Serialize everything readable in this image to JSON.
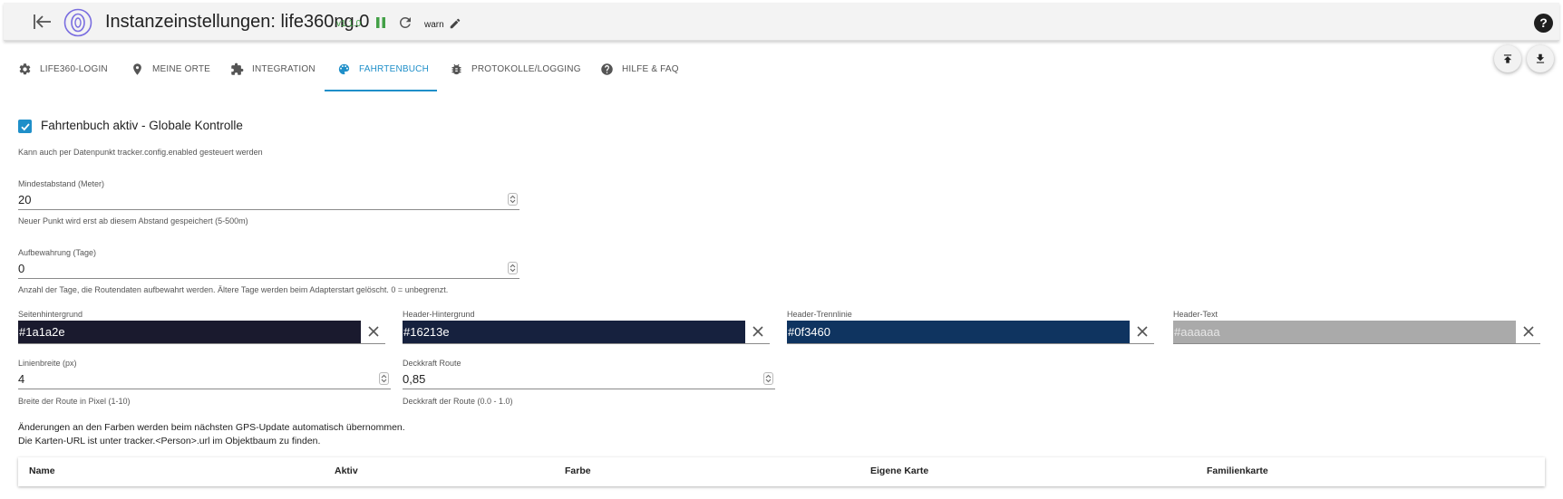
{
  "header": {
    "title": "Instanzeinstellungen: life360ng.0",
    "version": "v1.1.0",
    "log_level": "warn",
    "help_symbol": "?"
  },
  "tabs": [
    {
      "label": "LIFE360-LOGIN",
      "icon": "gear-icon"
    },
    {
      "label": "MEINE ORTE",
      "icon": "map-pin-icon"
    },
    {
      "label": "INTEGRATION",
      "icon": "puzzle-icon"
    },
    {
      "label": "FAHRTENBUCH",
      "icon": "palette-icon",
      "active": true
    },
    {
      "label": "PROTOKOLLE/LOGGING",
      "icon": "bug-icon"
    },
    {
      "label": "HILFE & FAQ",
      "icon": "help-circle-icon"
    }
  ],
  "form": {
    "enabled": {
      "label": "Fahrtenbuch aktiv - Globale Kontrolle",
      "checked": true,
      "help": "Kann auch per Datenpunkt tracker.config.enabled gesteuert werden"
    },
    "min_distance": {
      "label": "Mindestabstand (Meter)",
      "value": "20",
      "help": "Neuer Punkt wird erst ab diesem Abstand gespeichert (5-500m)"
    },
    "retention": {
      "label": "Aufbewahrung (Tage)",
      "value": "0",
      "help": "Anzahl der Tage, die Routendaten aufbewahrt werden. Ältere Tage werden beim Adapterstart gelöscht. 0 = unbegrenzt."
    },
    "colors": [
      {
        "label": "Seitenhintergrund",
        "value": "#1a1a2e",
        "text_color": "#ffffff"
      },
      {
        "label": "Header-Hintergrund",
        "value": "#16213e",
        "text_color": "#ffffff"
      },
      {
        "label": "Header-Trennlinie",
        "value": "#0f3460",
        "text_color": "#ffffff"
      },
      {
        "label": "Header-Text",
        "value": "#aaaaaa",
        "text_color": "#e6e6e6"
      }
    ],
    "line_width": {
      "label": "Linienbreite (px)",
      "value": "4",
      "help": "Breite der Route in Pixel (1-10)"
    },
    "route_opacity": {
      "label": "Deckkraft Route",
      "value": "0,85",
      "help": "Deckkraft der Route (0.0 - 1.0)"
    },
    "note_line1": "Änderungen an den Farben werden beim nächsten GPS-Update automatisch übernommen.",
    "note_line2": "Die Karten-URL ist unter tracker.<Person>.url im Objektbaum zu finden."
  },
  "table": {
    "columns": [
      "Name",
      "Aktiv",
      "Farbe",
      "Eigene Karte",
      "Familienkarte"
    ]
  },
  "colors": {
    "accent": "#1f8fc9",
    "running": "#43a047"
  }
}
